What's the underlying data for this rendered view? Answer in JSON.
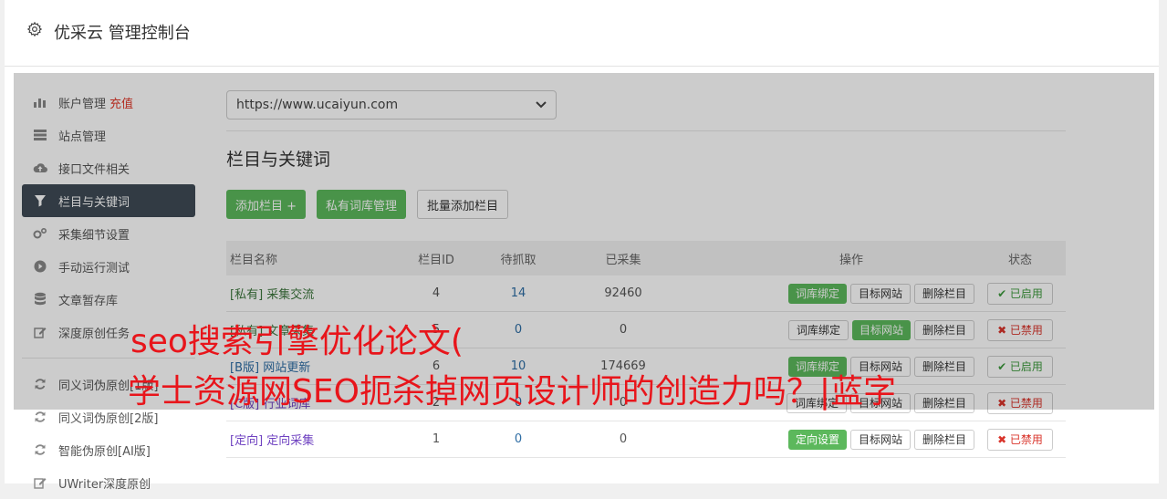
{
  "header": {
    "title": "优采云 管理控制台",
    "icon": "gear-icon"
  },
  "sidebar": {
    "items": [
      {
        "label": "账户管理",
        "extra": "充值",
        "icon": "bar-chart-icon"
      },
      {
        "label": "站点管理",
        "icon": "server-icon"
      },
      {
        "label": "接口文件相关",
        "icon": "cloud-upload-icon"
      },
      {
        "label": "栏目与关键词",
        "icon": "filter-icon",
        "active": true
      },
      {
        "label": "采集细节设置",
        "icon": "cogs-icon"
      },
      {
        "label": "手动运行测试",
        "icon": "play-icon"
      },
      {
        "label": "文章暂存库",
        "icon": "database-icon"
      },
      {
        "label": "深度原创任务",
        "icon": "edit-icon"
      },
      {
        "label": "同义词伪原创[1版]",
        "icon": "refresh-icon"
      },
      {
        "label": "同义词伪原创[2版]",
        "icon": "refresh-icon"
      },
      {
        "label": "智能伪原创[AI版]",
        "icon": "refresh-icon"
      },
      {
        "label": "UWriter深度原创",
        "icon": "edit-icon"
      }
    ]
  },
  "site_select": {
    "value": "https://www.ucaiyun.com"
  },
  "section": {
    "title": "栏目与关键词"
  },
  "toolbar": {
    "add_label": "添加栏目 +",
    "private_label": "私有词库管理",
    "batch_label": "批量添加栏目"
  },
  "table": {
    "headers": [
      "栏目名称",
      "栏目ID",
      "待抓取",
      "已采集",
      "操作",
      "状态"
    ],
    "rows": [
      {
        "tag": "[私有]",
        "name": "采集交流",
        "id": "4",
        "pending": "14",
        "collected": "92460",
        "op1": "词库绑定",
        "op2": "目标网站",
        "op3": "删除栏目",
        "status": "✔ 已启用"
      },
      {
        "tag": "[私有]",
        "name": "文章采集",
        "id": "5",
        "pending": "0",
        "collected": "0",
        "op1": "词库绑定",
        "op2": "目标网站",
        "op3": "删除栏目",
        "status": "✖ 已禁用"
      },
      {
        "tag": "[B版]",
        "name": "网站更新",
        "id": "6",
        "pending": "10",
        "collected": "174669",
        "op1": "词库绑定",
        "op2": "目标网站",
        "op3": "删除栏目",
        "status": "✔ 已启用"
      },
      {
        "tag": "[C版]",
        "name": "行业词库",
        "id": "2",
        "pending": "0",
        "collected": "0",
        "op1": "词库绑定",
        "op2": "目标网站",
        "op3": "删除栏目",
        "status": "✖ 已禁用"
      },
      {
        "tag": "[定向]",
        "name": "定向采集",
        "id": "1",
        "pending": "0",
        "collected": "0",
        "op1": "定向设置",
        "op2": "目标网站",
        "op3": "删除栏目",
        "status": "✖ 已禁用"
      }
    ]
  },
  "watermark": {
    "line1": "seo搜索引擎优化论文(",
    "line2": "学士资源网SEO扼杀掉网页设计师的创造力吗？|蓝字"
  },
  "colors": {
    "accent_green": "#5cb85c",
    "sidebar_active": "#3f4a55",
    "watermark_red": "#e8151b"
  }
}
